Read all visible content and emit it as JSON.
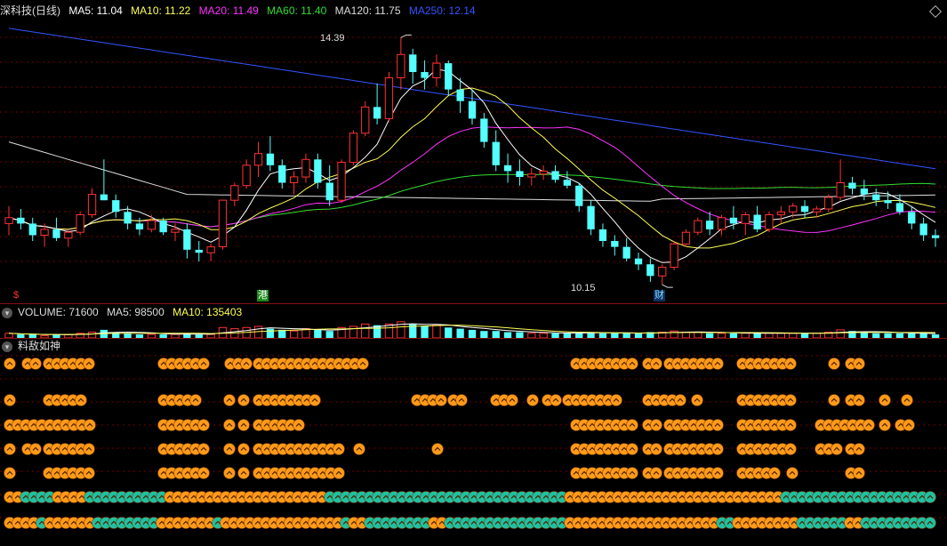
{
  "chart_header": {
    "title": "深科技(日线)",
    "ma": [
      {
        "label": "MA5: 11.04",
        "color": "#ffffff"
      },
      {
        "label": "MA10: 11.22",
        "color": "#ffff55"
      },
      {
        "label": "MA20: 11.49",
        "color": "#ff33ff"
      },
      {
        "label": "MA60: 11.40",
        "color": "#33dd33"
      },
      {
        "label": "MA120: 11.75",
        "color": "#dddddd"
      },
      {
        "label": "MA250: 12.14",
        "color": "#3355ff"
      }
    ],
    "collapse_icon": "diamond-icon"
  },
  "price_labels": {
    "high": "14.39",
    "low": "10.15"
  },
  "event_markers": [
    {
      "text": "$",
      "color": "#ff3333",
      "bg": "transparent"
    },
    {
      "text": "港",
      "color": "#ffffff",
      "bg": "#1a8a1a"
    },
    {
      "text": "财",
      "color": "#7fdfff",
      "bg": "#103060"
    }
  ],
  "volume_header": {
    "volume": "VOLUME: 71600",
    "ma5": "MA5: 98500",
    "ma10": "MA10: 135403"
  },
  "indicator_header": {
    "title": "料敌如神"
  },
  "colors": {
    "up": "#ff3232",
    "down": "#54ffff",
    "ma5": "#ffffff",
    "ma10": "#ffff55",
    "ma20": "#ff33ff",
    "ma60": "#33dd33",
    "ma120": "#dddddd",
    "ma250": "#3355ff",
    "grid": "#7a0000",
    "icon_orange": "#ff9a1a",
    "icon_teal": "#20c0a0"
  },
  "chart_data": {
    "type": "candlestick",
    "title": "深科技(日线)",
    "high_marker": 14.39,
    "low_marker": 10.15,
    "candles_ohlc": [
      [
        11.2,
        11.5,
        11.0,
        11.3
      ],
      [
        11.3,
        11.45,
        11.1,
        11.2
      ],
      [
        11.2,
        11.3,
        10.9,
        11.0
      ],
      [
        11.0,
        11.2,
        10.8,
        11.1
      ],
      [
        11.1,
        11.3,
        10.9,
        10.95
      ],
      [
        10.95,
        11.1,
        10.8,
        11.05
      ],
      [
        11.05,
        11.4,
        11.0,
        11.35
      ],
      [
        11.35,
        11.8,
        11.3,
        11.7
      ],
      [
        11.7,
        12.3,
        11.6,
        11.6
      ],
      [
        11.6,
        11.7,
        11.3,
        11.4
      ],
      [
        11.4,
        11.5,
        11.1,
        11.2
      ],
      [
        11.2,
        11.3,
        11.0,
        11.1
      ],
      [
        11.1,
        11.35,
        11.05,
        11.25
      ],
      [
        11.25,
        11.3,
        11.0,
        11.05
      ],
      [
        11.05,
        11.2,
        10.9,
        11.1
      ],
      [
        11.1,
        11.2,
        10.6,
        10.75
      ],
      [
        10.75,
        10.9,
        10.55,
        10.7
      ],
      [
        10.7,
        10.85,
        10.55,
        10.8
      ],
      [
        10.8,
        11.6,
        10.75,
        11.6
      ],
      [
        11.6,
        11.9,
        11.5,
        11.85
      ],
      [
        11.85,
        12.3,
        11.8,
        12.2
      ],
      [
        12.2,
        12.6,
        12.0,
        12.4
      ],
      [
        12.4,
        12.7,
        12.1,
        12.2
      ],
      [
        12.2,
        12.3,
        11.8,
        11.9
      ],
      [
        11.9,
        12.1,
        11.7,
        12.0
      ],
      [
        12.0,
        12.4,
        11.9,
        12.3
      ],
      [
        12.3,
        12.4,
        11.8,
        11.9
      ],
      [
        11.9,
        12.2,
        11.5,
        11.6
      ],
      [
        11.6,
        12.3,
        11.55,
        12.25
      ],
      [
        12.25,
        12.8,
        12.2,
        12.75
      ],
      [
        12.75,
        13.3,
        12.7,
        13.2
      ],
      [
        13.2,
        13.6,
        12.9,
        13.0
      ],
      [
        13.0,
        13.8,
        12.95,
        13.7
      ],
      [
        13.7,
        14.39,
        13.5,
        14.1
      ],
      [
        14.1,
        14.2,
        13.6,
        13.8
      ],
      [
        13.8,
        14.0,
        13.5,
        13.7
      ],
      [
        13.7,
        14.1,
        13.55,
        13.95
      ],
      [
        13.95,
        14.0,
        13.4,
        13.5
      ],
      [
        13.5,
        13.7,
        13.1,
        13.3
      ],
      [
        13.3,
        13.5,
        12.9,
        13.0
      ],
      [
        13.0,
        13.1,
        12.5,
        12.6
      ],
      [
        12.6,
        12.8,
        12.1,
        12.2
      ],
      [
        12.2,
        12.4,
        11.9,
        12.1
      ],
      [
        12.1,
        12.3,
        11.85,
        12.0
      ],
      [
        12.0,
        12.15,
        11.85,
        12.05
      ],
      [
        12.05,
        12.2,
        11.95,
        12.1
      ],
      [
        12.1,
        12.2,
        11.9,
        11.95
      ],
      [
        11.95,
        12.1,
        11.8,
        11.85
      ],
      [
        11.85,
        11.9,
        11.4,
        11.5
      ],
      [
        11.5,
        11.6,
        11.0,
        11.1
      ],
      [
        11.1,
        11.2,
        10.8,
        10.9
      ],
      [
        10.9,
        11.0,
        10.65,
        10.8
      ],
      [
        10.8,
        10.95,
        10.55,
        10.6
      ],
      [
        10.6,
        10.7,
        10.4,
        10.5
      ],
      [
        10.5,
        10.6,
        10.2,
        10.3
      ],
      [
        10.3,
        10.5,
        10.15,
        10.45
      ],
      [
        10.45,
        10.9,
        10.4,
        10.85
      ],
      [
        10.85,
        11.1,
        10.8,
        11.05
      ],
      [
        11.05,
        11.3,
        11.0,
        11.25
      ],
      [
        11.25,
        11.4,
        11.0,
        11.1
      ],
      [
        11.1,
        11.35,
        11.0,
        11.3
      ],
      [
        11.3,
        11.5,
        11.1,
        11.2
      ],
      [
        11.2,
        11.4,
        11.0,
        11.35
      ],
      [
        11.35,
        11.5,
        11.05,
        11.1
      ],
      [
        11.1,
        11.4,
        11.05,
        11.35
      ],
      [
        11.35,
        11.5,
        11.2,
        11.4
      ],
      [
        11.4,
        11.55,
        11.3,
        11.5
      ],
      [
        11.5,
        11.6,
        11.3,
        11.4
      ],
      [
        11.4,
        11.5,
        11.3,
        11.45
      ],
      [
        11.45,
        11.7,
        11.4,
        11.65
      ],
      [
        11.65,
        12.3,
        11.6,
        11.9
      ],
      [
        11.9,
        12.0,
        11.7,
        11.8
      ],
      [
        11.8,
        11.95,
        11.6,
        11.7
      ],
      [
        11.7,
        11.8,
        11.5,
        11.6
      ],
      [
        11.6,
        11.75,
        11.45,
        11.55
      ],
      [
        11.55,
        11.7,
        11.35,
        11.4
      ],
      [
        11.4,
        11.5,
        11.1,
        11.2
      ],
      [
        11.2,
        11.3,
        10.9,
        11.0
      ],
      [
        11.0,
        11.1,
        10.8,
        10.95
      ]
    ]
  },
  "volume_data": {
    "values": [
      4,
      3,
      3,
      2,
      3,
      3,
      4,
      5,
      7,
      5,
      4,
      3,
      3,
      3,
      3,
      4,
      3,
      3,
      9,
      8,
      9,
      10,
      8,
      7,
      6,
      8,
      7,
      6,
      9,
      10,
      12,
      11,
      12,
      14,
      12,
      10,
      11,
      9,
      8,
      7,
      6,
      6,
      5,
      5,
      4,
      4,
      4,
      4,
      5,
      5,
      4,
      4,
      4,
      4,
      5,
      5,
      6,
      5,
      5,
      4,
      4,
      4,
      4,
      4,
      4,
      4,
      4,
      4,
      4,
      5,
      7,
      6,
      5,
      4,
      4,
      4,
      4,
      4,
      3
    ]
  },
  "indicator_rows": {
    "row_count": 7,
    "note_row_patterns": "rows 0-4 orange icon runs, rows 5-6 full-width mixed orange/teal"
  }
}
